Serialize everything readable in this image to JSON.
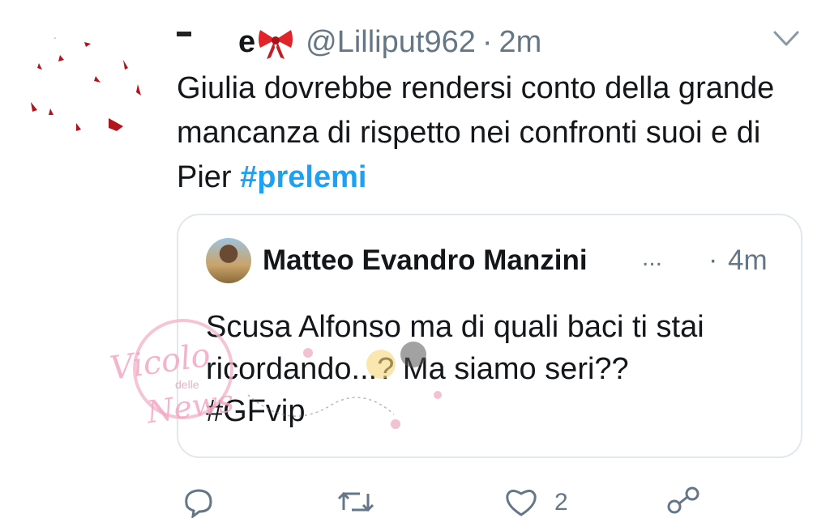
{
  "tweet": {
    "display_name_visible": "e",
    "handle": "@Lilliput962",
    "separator": "·",
    "time": "2m",
    "text_before": "Giulia dovrebbe rendersi conto della grande mancanza di rispetto nei confronti suoi e di Pier ",
    "hashtag": "#prelemi"
  },
  "quoted_tweet": {
    "author_name": "Matteo Evandro Manzini",
    "ellipsis": "...",
    "separator": "·",
    "time": "4m",
    "text": "Scusa Alfonso ma di quali baci ti stai ricordando...? Ma siamo seri??",
    "hashtag": "#GFvip"
  },
  "actions": {
    "like_count": "2"
  },
  "watermark": {
    "line1": "Vicolo",
    "line2": "delle",
    "line3": "News"
  },
  "icons": {
    "bow": "red-bow-emoji",
    "caret": "chevron-down-icon",
    "reply": "reply-icon",
    "retweet": "retweet-icon",
    "like": "heart-icon",
    "share": "share-icon"
  },
  "colors": {
    "link": "#1da1f2",
    "secondary": "#657786",
    "border": "#e1e8ed",
    "bow": "#e0242a"
  }
}
